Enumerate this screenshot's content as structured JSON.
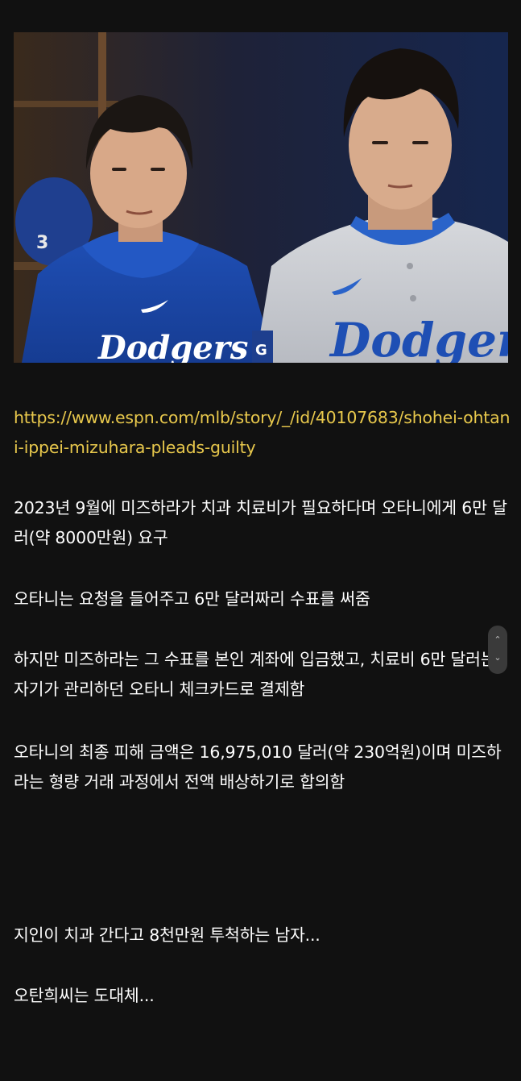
{
  "article": {
    "image": {
      "left_jersey_text": "Dodgers",
      "right_jersey_text": "Dodgers",
      "helmet_number": "3",
      "sleeve_letter": "G"
    },
    "link": "https://www.espn.com/mlb/story/_/id/40107683/shohei-ohtani-ippei-mizuhara-pleads-guilty",
    "paragraphs": [
      "2023년 9월에 미즈하라가 치과 치료비가 필요하다며 오타니에게 6만 달러(약 8000만원) 요구",
      "오타니는 요청을 들어주고 6만 달러짜리 수표를 써줌",
      "하지만 미즈하라는 그 수표를 본인 계좌에 입금했고, 치료비 6만 달러는 자기가 관리하던 오타니 체크카드로 결제함",
      "오타니의 최종 피해 금액은 16,975,010 달러(약 230억원)이며 미즈하라는 형량 거래 과정에서 전액 배상하기로 합의함",
      "지인이 치과 간다고 8천만원 투척하는 남자...",
      "오탄희씨는 도대체..."
    ]
  },
  "scroll_control": {
    "up_icon": "chevron-up-icon",
    "down_icon": "chevron-down-icon"
  },
  "colors": {
    "background": "#111111",
    "text": "#ffffff",
    "link": "#e8c84c",
    "dodgers_blue": "#1e4fb4"
  }
}
